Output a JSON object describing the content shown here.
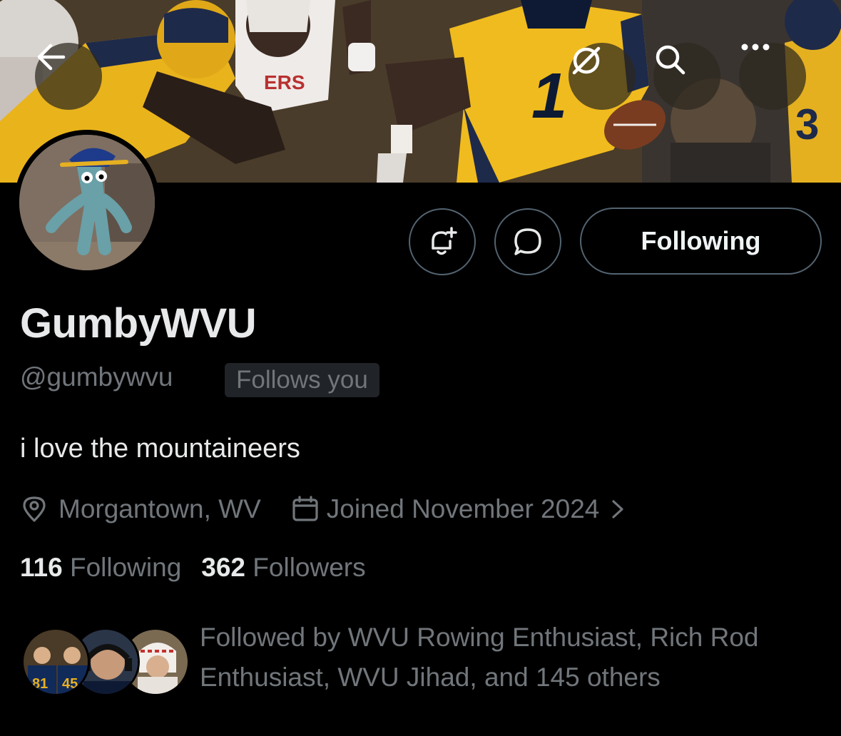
{
  "header": {
    "back_icon": "arrow-left-icon",
    "grok_icon": "grok-icon",
    "search_icon": "search-icon",
    "more_icon": "more-horizontal-icon"
  },
  "banner": {
    "jersey_number": "1",
    "jersey_number_2": "3"
  },
  "actions": {
    "notify_icon": "bell-plus-icon",
    "message_icon": "message-bubble-icon",
    "following_label": "Following"
  },
  "profile": {
    "display_name": "GumbyWVU",
    "handle": "@gumbywvu",
    "follows_you": "Follows you",
    "bio": "i love the mountaineers",
    "location": "Morgantown, WV",
    "joined": "Joined November 2024"
  },
  "stats": {
    "following_count": "116",
    "following_label": "Following",
    "followers_count": "362",
    "followers_label": "Followers"
  },
  "followed_by": {
    "text": "Followed by WVU Rowing Enthusiast, Rich Rod Enthusiast, WVU Jihad, and 145 others",
    "avatar_jersey_1": "81",
    "avatar_jersey_2": "45"
  },
  "colors": {
    "background": "#000000",
    "primary_text": "#e7e9ea",
    "secondary_text": "#71767b",
    "border": "#536471",
    "wvu_gold": "#eaaa00",
    "wvu_blue": "#002855"
  }
}
